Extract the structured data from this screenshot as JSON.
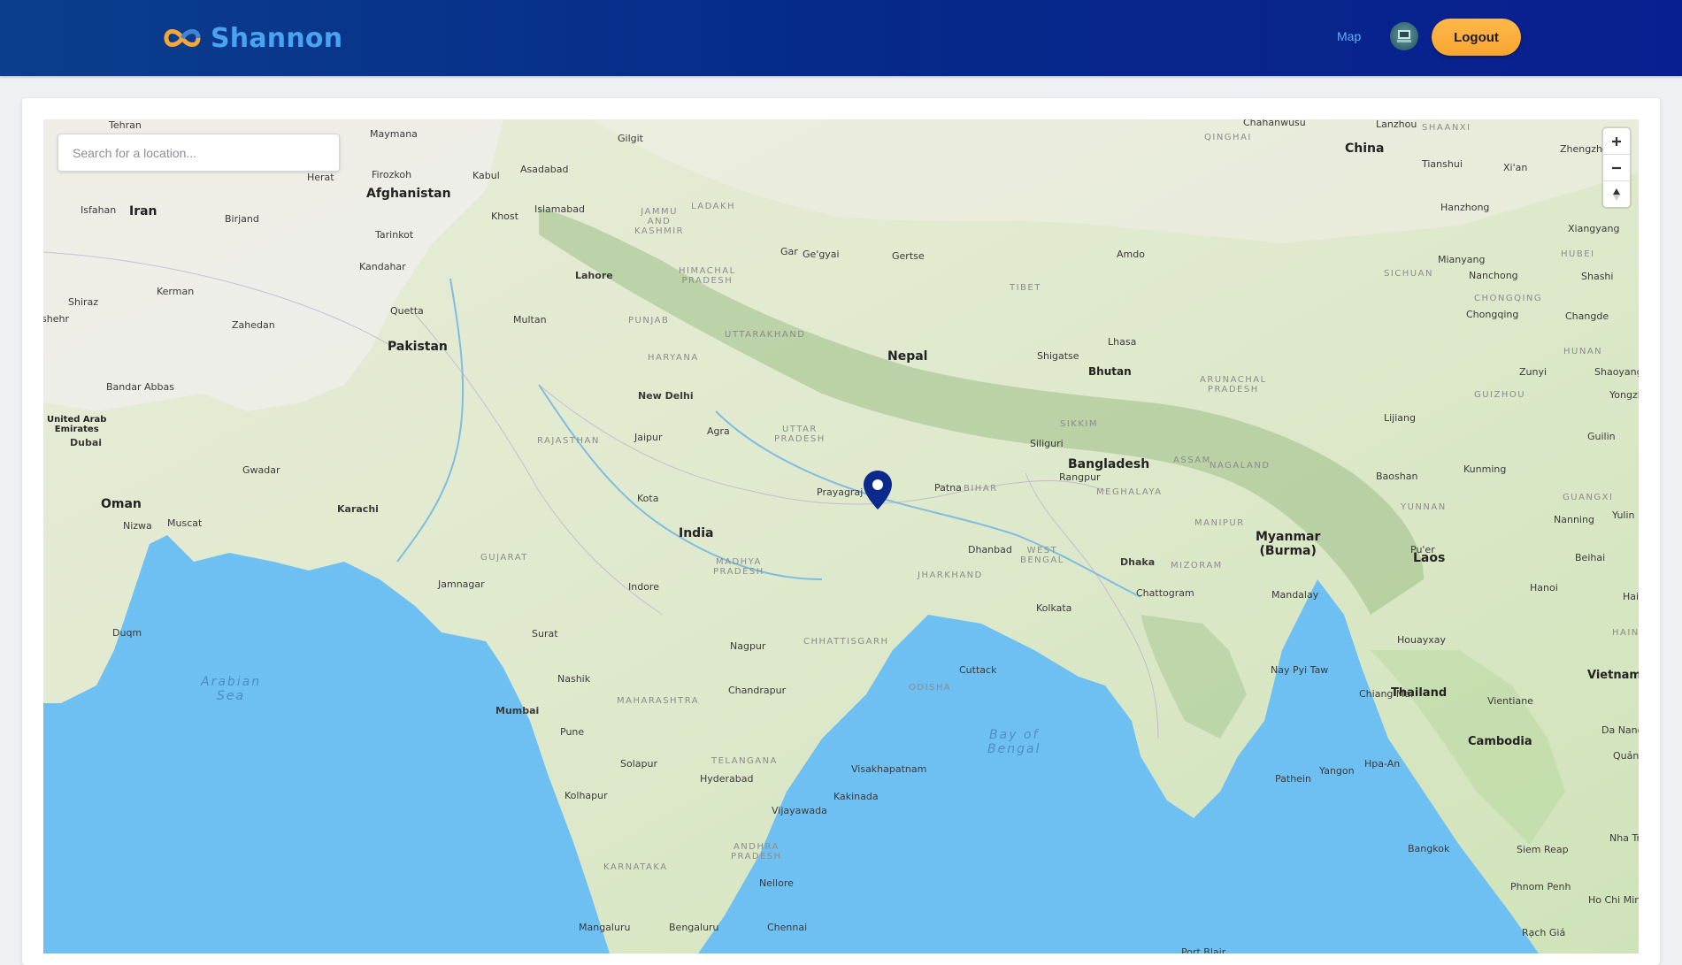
{
  "app": {
    "name": "Shannon"
  },
  "nav": {
    "map_label": "Map",
    "logout_label": "Logout"
  },
  "search": {
    "placeholder": "Search for a location..."
  },
  "icons": {
    "logo": "infinity-logo-icon",
    "avatar": "user-avatar",
    "zoom_in": "plus-icon",
    "zoom_out": "minus-icon",
    "compass": "compass-icon",
    "marker": "map-pin-icon"
  },
  "colors": {
    "header": "#052a8a",
    "brand": "#4aa3f0",
    "logout": "#f9a530",
    "marker": "#0b2a8c"
  },
  "map": {
    "marker_label": "Prayagraj",
    "countries": {
      "china": "China",
      "afghanistan": "Afghanistan",
      "iran": "Iran",
      "pakistan": "Pakistan",
      "nepal": "Nepal",
      "bhutan": "Bhutan",
      "bangladesh": "Bangladesh",
      "india": "India",
      "myanmar1": "Myanmar",
      "myanmar2": "(Burma)",
      "laos": "Laos",
      "thailand": "Thailand",
      "cambodia": "Cambodia",
      "vietnam": "Vietnam",
      "oman": "Oman",
      "uae1": "United Arab",
      "uae2": "Emirates"
    },
    "regions": {
      "qinghai": "QINGHAI",
      "shaanxi": "SHAANXI",
      "jk1": "JAMMU",
      "jk2": "AND",
      "jk3": "KASHMIR",
      "ladakh": "LADAKH",
      "hp1": "HIMACHAL",
      "hp2": "PRADESH",
      "punjab": "PUNJAB",
      "haryana": "HARYANA",
      "uttarakhand": "UTTARAKHAND",
      "tibet": "TIBET",
      "sichuan": "SICHUAN",
      "hubei": "HUBEI",
      "chongqing": "CHONGQING",
      "hunan": "HUNAN",
      "guizhou": "GUIZHOU",
      "yunnan": "YUNNAN",
      "guangxi": "GUANGXI",
      "arunachal1": "ARUNACHAL",
      "arunachal2": "PRADESH",
      "sikkim": "SIKKIM",
      "assam": "ASSAM",
      "nagaland": "NAGALAND",
      "meghalaya": "MEGHALAYA",
      "manipur": "MANIPUR",
      "mizoram": "MIZORAM",
      "rajasthan": "RAJASTHAN",
      "up1": "UTTAR",
      "up2": "PRADESH",
      "bihar": "BIHAR",
      "wb1": "WEST",
      "wb2": "BENGAL",
      "jharkhand": "JHARKHAND",
      "gujarat": "GUJARAT",
      "mp1": "MADHYA",
      "mp2": "PRADESH",
      "chhattisgarh": "CHHATTISGARH",
      "odisha": "ODISHA",
      "maharashtra": "MAHARASHTRA",
      "telangana": "TELANGANA",
      "ap1": "ANDHRA",
      "ap2": "PRADESH",
      "karnataka": "KARNATAKA",
      "hainan": "HAINA"
    },
    "seas": {
      "arabian1": "Arabian",
      "arabian2": "Sea",
      "bengal1": "Bay of",
      "bengal2": "Bengal"
    },
    "cities": {
      "tehran": "Tehran",
      "mashhad": "Mashhad",
      "maymana": "Maymana",
      "gilgit": "Gilgit",
      "chahanwusu": "Chahanwusu",
      "lanzhou": "Lanzhou",
      "zhengzhou": "Zhengzho",
      "tianshui": "Tianshui",
      "xian": "Xi'an",
      "herat": "Herat",
      "firozkoh": "Firozkoh",
      "kabul": "Kabul",
      "asadabad": "Asadabad",
      "isfahan": "Isfahan",
      "birjand": "Birjand",
      "khost": "Khost",
      "islamabad": "Islamabad",
      "hanzhong": "Hanzhong",
      "xiangyang": "Xiangyang",
      "tarinkot": "Tarinkot",
      "gar": "Gar",
      "geygyai": "Ge'gyai",
      "gertse": "Gertse",
      "amdo": "Amdo",
      "mianyang": "Mianyang",
      "kandahar": "Kandahar",
      "lahore": "Lahore",
      "nanchong": "Nanchong",
      "shashi": "Shashi",
      "kerman": "Kerman",
      "shiraz": "Shiraz",
      "quetta": "Quetta",
      "multan": "Multan",
      "chongqing": "Chongqing",
      "changde": "Changde",
      "zahedan": "Zahedan",
      "lhasa": "Lhasa",
      "shigatse": "Shigatse",
      "zunyi": "Zunyi",
      "shaoyang": "Shaoyang",
      "bandarabbas": "Bandar Abbas",
      "newdelhi": "New Delhi",
      "yongzhou": "Yongzh",
      "lijiang": "Lijiang",
      "dubai": "Dubai",
      "jaipur": "Jaipur",
      "agra": "Agra",
      "siliguri": "Siliguri",
      "guilin": "Guilin",
      "gwadar": "Gwadar",
      "kunming": "Kunming",
      "rangpur": "Rangpur",
      "patna": "Patna",
      "baoshan": "Baoshan",
      "kota": "Kota",
      "karachi": "Karachi",
      "muscat": "Muscat",
      "nizwa": "Nizwa",
      "nanning": "Nanning",
      "yulin": "Yulin",
      "dhanbad": "Dhanbad",
      "dhaka": "Dhaka",
      "puer": "Pu'er",
      "beihai": "Beihai",
      "jamnagar": "Jamnagar",
      "indore": "Indore",
      "chattogram": "Chattogram",
      "mandalay": "Mandalay",
      "hanoi": "Hanoi",
      "haiphong": "Hai",
      "kolkata": "Kolkata",
      "surat": "Surat",
      "duqm": "Duqm",
      "nagpur": "Nagpur",
      "houayxay": "Houayxay",
      "cuttack": "Cuttack",
      "naypyitaw": "Nay Pyi Taw",
      "nashik": "Nashik",
      "chandrapur": "Chandrapur",
      "chiangmai": "Chiang Mai",
      "vientiane": "Vientiane",
      "mumbai": "Mumbai",
      "pune": "Pune",
      "danang": "Da Nang",
      "quangngai": "Quảng Ng",
      "solapur": "Solapur",
      "pathein": "Pathein",
      "yangon": "Yangon",
      "hpaan": "Hpa-An",
      "visakhapatnam": "Visakhapatnam",
      "hyderabad": "Hyderabad",
      "kakinada": "Kakinada",
      "kolhapur": "Kolhapur",
      "vijayawada": "Vijayawada",
      "nhatrang": "Nha Tra",
      "siemreap": "Siem Reap",
      "bangkok": "Bangkok",
      "nellore": "Nellore",
      "phnompenh": "Phnom Penh",
      "hochiminh": "Ho Chi Minh",
      "mangaluru": "Mangaluru",
      "bengaluru": "Bengaluru",
      "chennai": "Chennai",
      "rachgia": "Rạch Giá",
      "portblair": "Port Blair",
      "ahvaz": "shehr"
    }
  }
}
